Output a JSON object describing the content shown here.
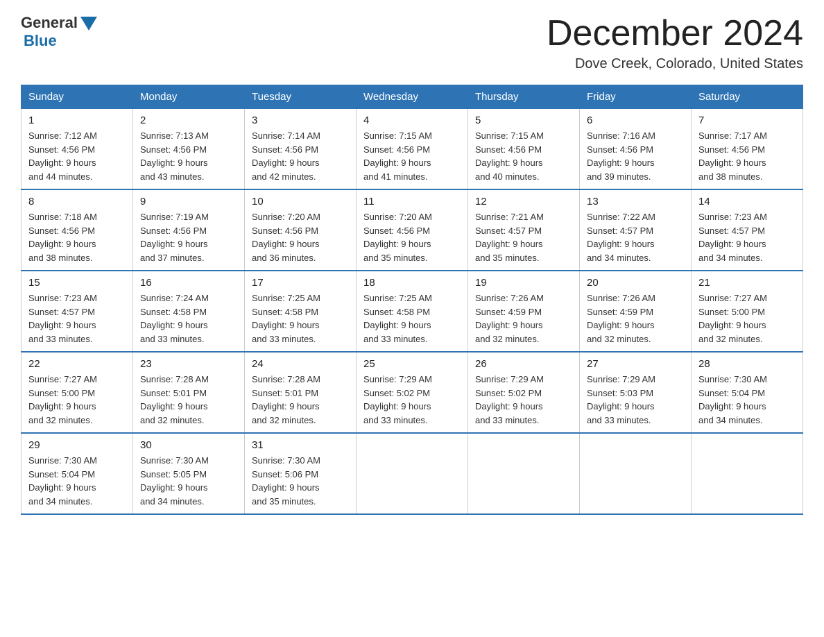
{
  "logo": {
    "text_general": "General",
    "text_blue": "Blue"
  },
  "header": {
    "title": "December 2024",
    "subtitle": "Dove Creek, Colorado, United States"
  },
  "weekdays": [
    "Sunday",
    "Monday",
    "Tuesday",
    "Wednesday",
    "Thursday",
    "Friday",
    "Saturday"
  ],
  "weeks": [
    [
      {
        "day": "1",
        "sunrise": "7:12 AM",
        "sunset": "4:56 PM",
        "daylight": "9 hours and 44 minutes."
      },
      {
        "day": "2",
        "sunrise": "7:13 AM",
        "sunset": "4:56 PM",
        "daylight": "9 hours and 43 minutes."
      },
      {
        "day": "3",
        "sunrise": "7:14 AM",
        "sunset": "4:56 PM",
        "daylight": "9 hours and 42 minutes."
      },
      {
        "day": "4",
        "sunrise": "7:15 AM",
        "sunset": "4:56 PM",
        "daylight": "9 hours and 41 minutes."
      },
      {
        "day": "5",
        "sunrise": "7:15 AM",
        "sunset": "4:56 PM",
        "daylight": "9 hours and 40 minutes."
      },
      {
        "day": "6",
        "sunrise": "7:16 AM",
        "sunset": "4:56 PM",
        "daylight": "9 hours and 39 minutes."
      },
      {
        "day": "7",
        "sunrise": "7:17 AM",
        "sunset": "4:56 PM",
        "daylight": "9 hours and 38 minutes."
      }
    ],
    [
      {
        "day": "8",
        "sunrise": "7:18 AM",
        "sunset": "4:56 PM",
        "daylight": "9 hours and 38 minutes."
      },
      {
        "day": "9",
        "sunrise": "7:19 AM",
        "sunset": "4:56 PM",
        "daylight": "9 hours and 37 minutes."
      },
      {
        "day": "10",
        "sunrise": "7:20 AM",
        "sunset": "4:56 PM",
        "daylight": "9 hours and 36 minutes."
      },
      {
        "day": "11",
        "sunrise": "7:20 AM",
        "sunset": "4:56 PM",
        "daylight": "9 hours and 35 minutes."
      },
      {
        "day": "12",
        "sunrise": "7:21 AM",
        "sunset": "4:57 PM",
        "daylight": "9 hours and 35 minutes."
      },
      {
        "day": "13",
        "sunrise": "7:22 AM",
        "sunset": "4:57 PM",
        "daylight": "9 hours and 34 minutes."
      },
      {
        "day": "14",
        "sunrise": "7:23 AM",
        "sunset": "4:57 PM",
        "daylight": "9 hours and 34 minutes."
      }
    ],
    [
      {
        "day": "15",
        "sunrise": "7:23 AM",
        "sunset": "4:57 PM",
        "daylight": "9 hours and 33 minutes."
      },
      {
        "day": "16",
        "sunrise": "7:24 AM",
        "sunset": "4:58 PM",
        "daylight": "9 hours and 33 minutes."
      },
      {
        "day": "17",
        "sunrise": "7:25 AM",
        "sunset": "4:58 PM",
        "daylight": "9 hours and 33 minutes."
      },
      {
        "day": "18",
        "sunrise": "7:25 AM",
        "sunset": "4:58 PM",
        "daylight": "9 hours and 33 minutes."
      },
      {
        "day": "19",
        "sunrise": "7:26 AM",
        "sunset": "4:59 PM",
        "daylight": "9 hours and 32 minutes."
      },
      {
        "day": "20",
        "sunrise": "7:26 AM",
        "sunset": "4:59 PM",
        "daylight": "9 hours and 32 minutes."
      },
      {
        "day": "21",
        "sunrise": "7:27 AM",
        "sunset": "5:00 PM",
        "daylight": "9 hours and 32 minutes."
      }
    ],
    [
      {
        "day": "22",
        "sunrise": "7:27 AM",
        "sunset": "5:00 PM",
        "daylight": "9 hours and 32 minutes."
      },
      {
        "day": "23",
        "sunrise": "7:28 AM",
        "sunset": "5:01 PM",
        "daylight": "9 hours and 32 minutes."
      },
      {
        "day": "24",
        "sunrise": "7:28 AM",
        "sunset": "5:01 PM",
        "daylight": "9 hours and 32 minutes."
      },
      {
        "day": "25",
        "sunrise": "7:29 AM",
        "sunset": "5:02 PM",
        "daylight": "9 hours and 33 minutes."
      },
      {
        "day": "26",
        "sunrise": "7:29 AM",
        "sunset": "5:02 PM",
        "daylight": "9 hours and 33 minutes."
      },
      {
        "day": "27",
        "sunrise": "7:29 AM",
        "sunset": "5:03 PM",
        "daylight": "9 hours and 33 minutes."
      },
      {
        "day": "28",
        "sunrise": "7:30 AM",
        "sunset": "5:04 PM",
        "daylight": "9 hours and 34 minutes."
      }
    ],
    [
      {
        "day": "29",
        "sunrise": "7:30 AM",
        "sunset": "5:04 PM",
        "daylight": "9 hours and 34 minutes."
      },
      {
        "day": "30",
        "sunrise": "7:30 AM",
        "sunset": "5:05 PM",
        "daylight": "9 hours and 34 minutes."
      },
      {
        "day": "31",
        "sunrise": "7:30 AM",
        "sunset": "5:06 PM",
        "daylight": "9 hours and 35 minutes."
      },
      null,
      null,
      null,
      null
    ]
  ]
}
